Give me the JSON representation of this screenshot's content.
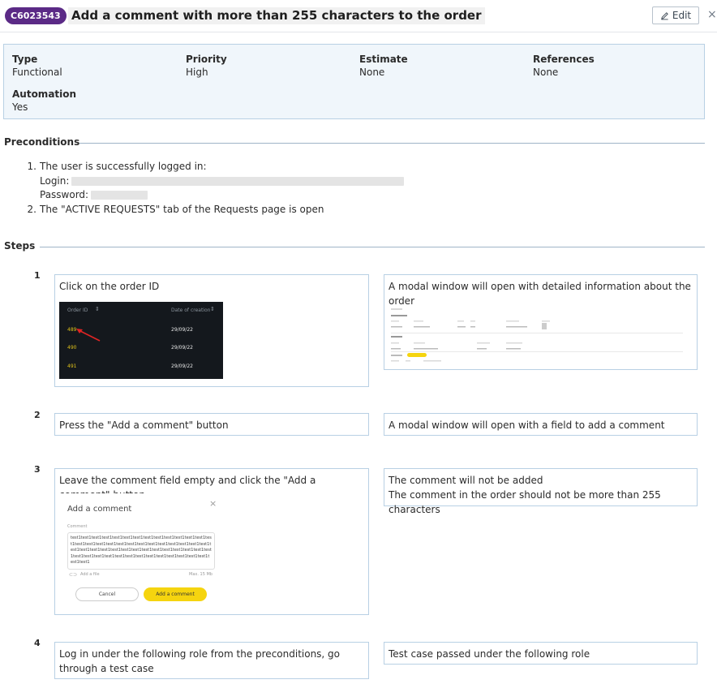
{
  "header": {
    "case_id": "C6023543",
    "title": "Add a comment with more than 255 characters to the order",
    "edit_label": "Edit",
    "close_label": "×"
  },
  "info": {
    "type": {
      "label": "Type",
      "value": "Functional"
    },
    "priority": {
      "label": "Priority",
      "value": "High"
    },
    "estimate": {
      "label": "Estimate",
      "value": "None"
    },
    "references": {
      "label": "References",
      "value": "None"
    },
    "automation": {
      "label": "Automation",
      "value": "Yes"
    }
  },
  "preconditions": {
    "title": "Preconditions",
    "items": [
      {
        "num": "1.",
        "text": "The user is successfully logged in:"
      },
      {
        "num": "2.",
        "text": "The \"ACTIVE REQUESTS\" tab of the Requests page is open"
      }
    ],
    "login_label": "Login:",
    "password_label": "Password:"
  },
  "steps": {
    "title": "Steps",
    "list": [
      {
        "num": "1",
        "action": "Click on the order ID",
        "expected": "A modal window will open with detailed information about the order"
      },
      {
        "num": "2",
        "action": "Press the \"Add a comment\" button",
        "expected": "A modal window will open with a field to add a comment"
      },
      {
        "num": "3",
        "action": "Leave the comment field empty and click the \"Add a comment\" button",
        "expected_line1": "The comment will not be added",
        "expected_line2": "The comment in the order should not be more than 255 characters"
      },
      {
        "num": "4",
        "action": "Log in under the following role from the preconditions, go through a test case",
        "expected": "Test case passed under the following role"
      }
    ]
  },
  "screenshot1": {
    "col_order": "Order ID",
    "col_date": "Date of creation",
    "rows": [
      {
        "id": "489",
        "date": "29/09/22"
      },
      {
        "id": "490",
        "date": "29/09/22"
      },
      {
        "id": "491",
        "date": "29/09/22"
      }
    ]
  },
  "screenshot3": {
    "title": "Add a comment",
    "close": "×",
    "field_label": "Comment",
    "field_text": "test1test1test1test1test1test1test1test1test1test1test1test1test1test1test1test1test1test1test1test1test1test1test1test1test1test1test1test1test1test1test1test1test1test1test1test1test1test1test1test1test1test1test1test1test1test1test1test1test1test1test1test1test1test1test1test1",
    "attach_label": "Add a file",
    "max_label": "Max. 15 Mb",
    "cancel_label": "Cancel",
    "submit_label": "Add a comment"
  },
  "colors": {
    "badge": "#5b2a86",
    "info_bg": "#f0f6fb",
    "border": "#b8d0e4",
    "accent_yellow": "#f5d40f"
  }
}
